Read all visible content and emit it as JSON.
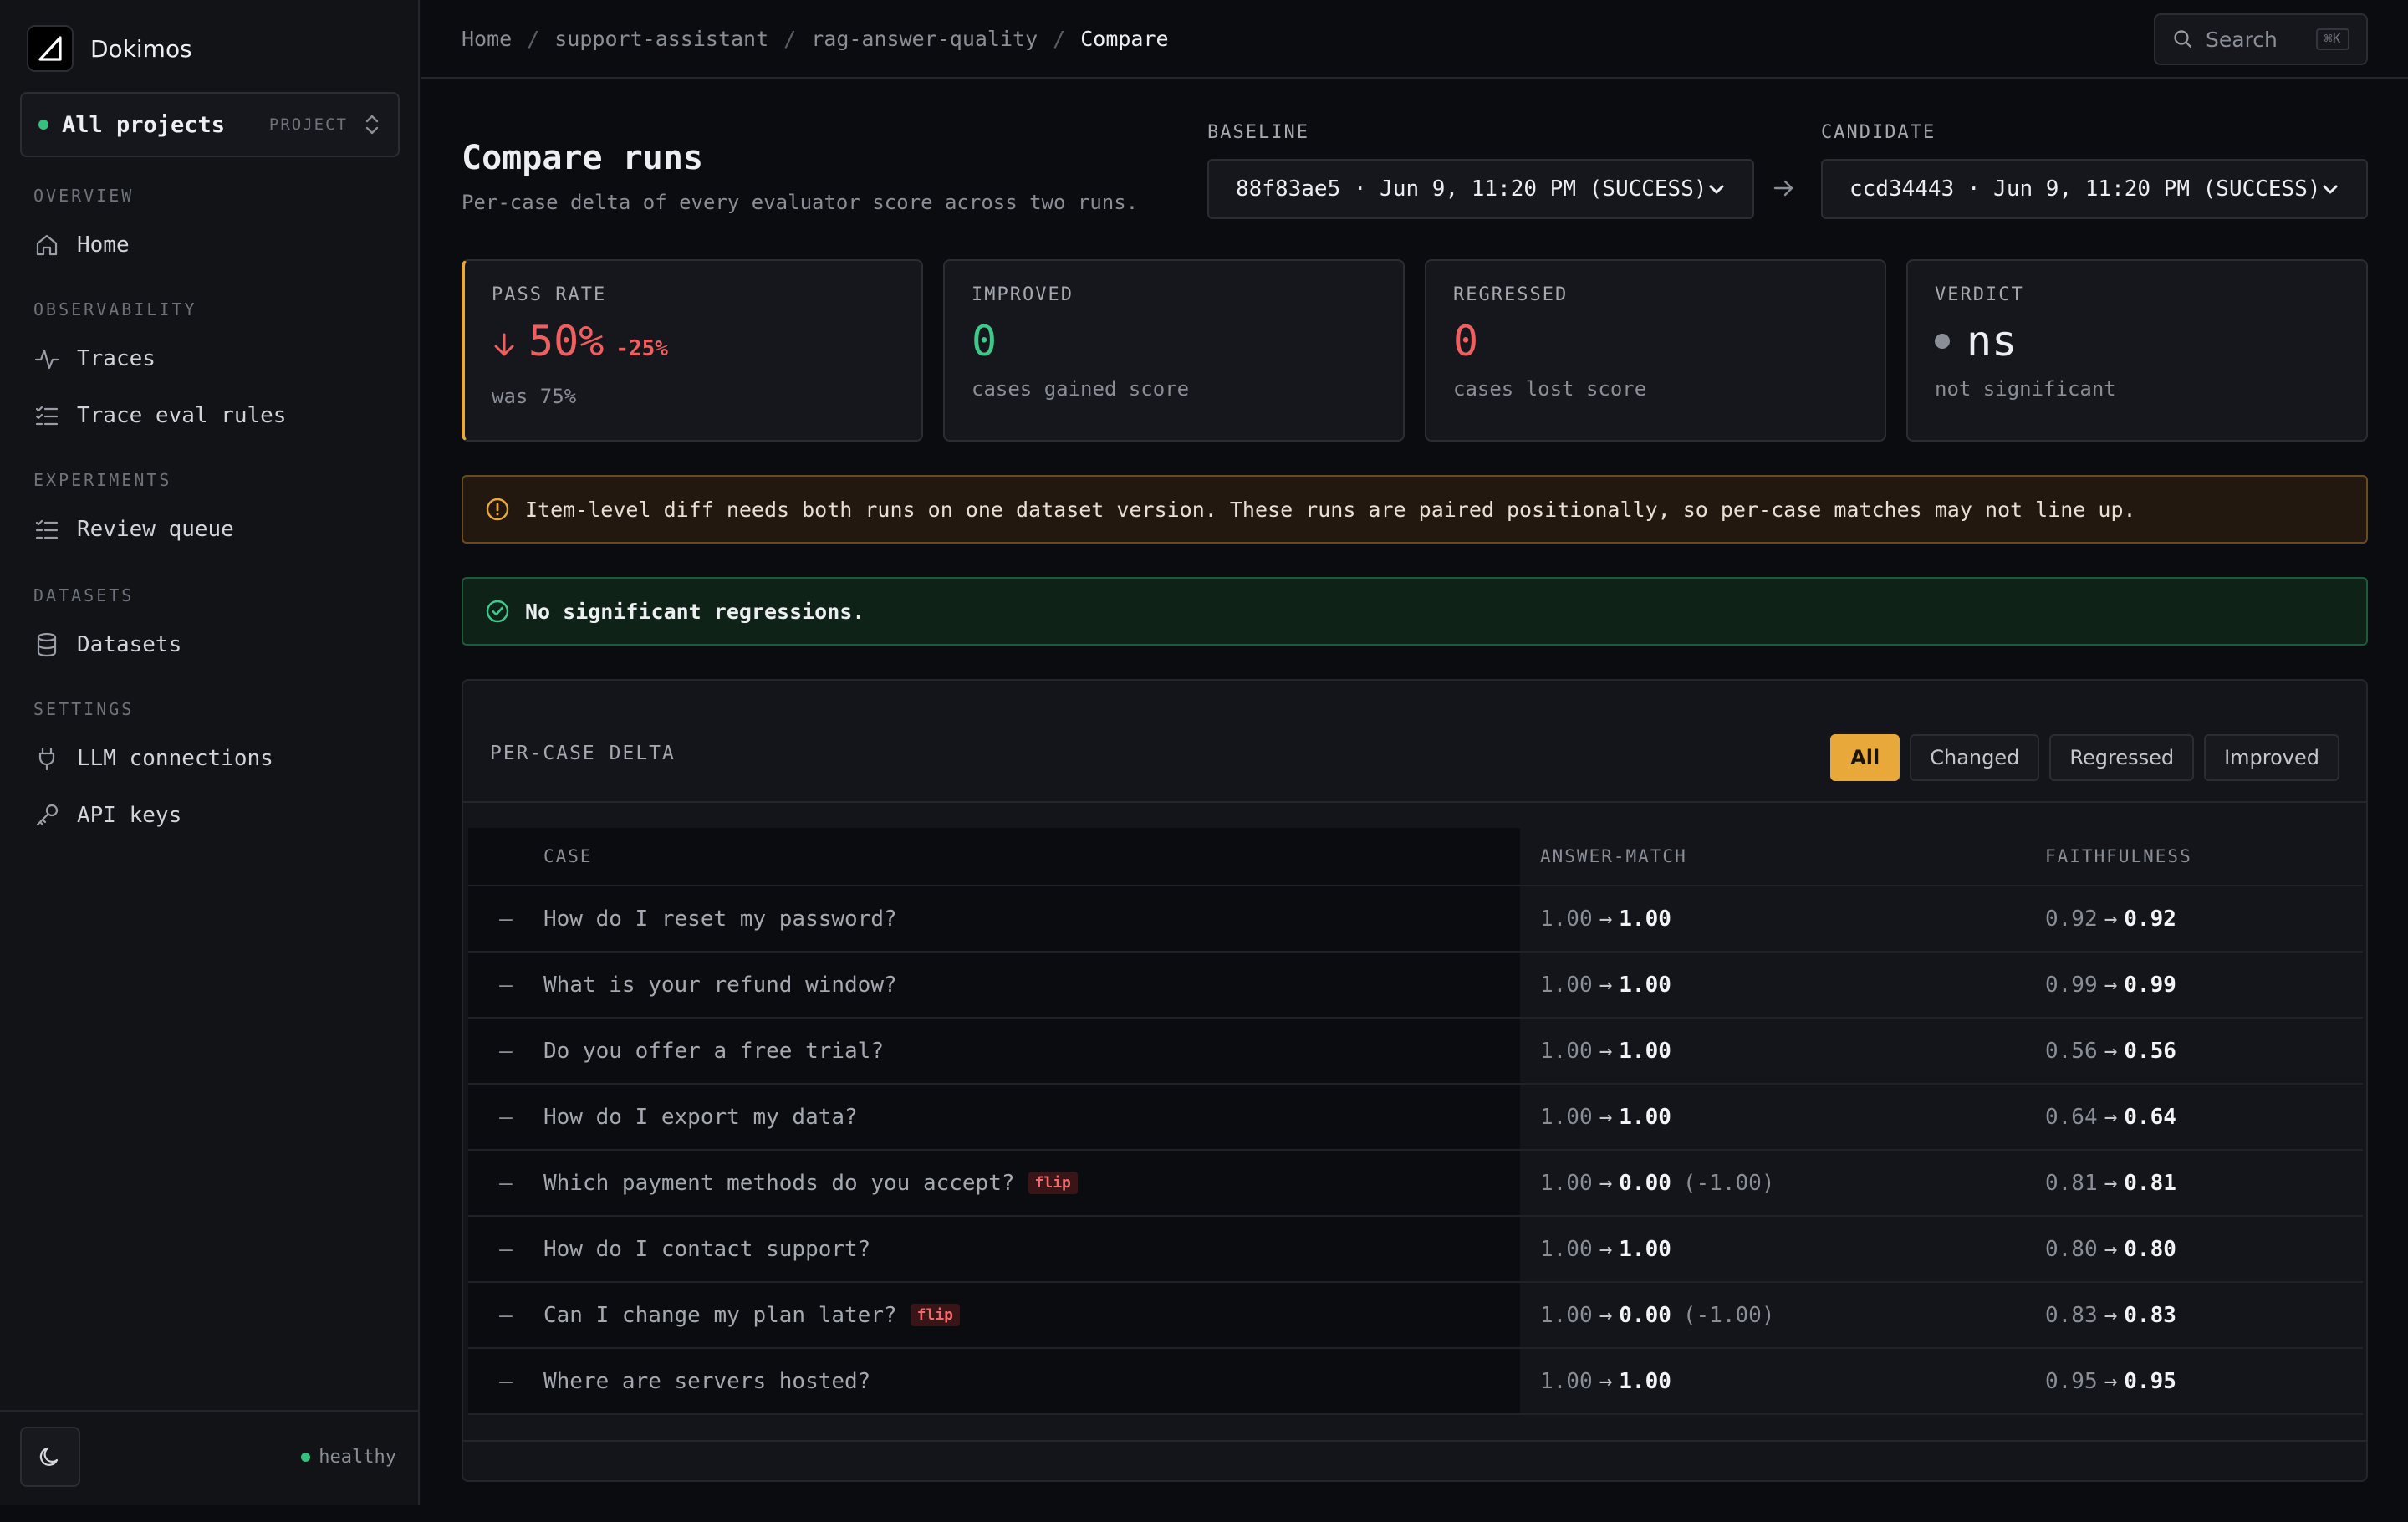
{
  "app": {
    "name": "Dokimos"
  },
  "project": {
    "name": "All projects",
    "tag": "PROJECT"
  },
  "nav": {
    "sections": [
      {
        "title": "OVERVIEW",
        "items": [
          {
            "label": "Home",
            "icon": "home-icon"
          }
        ]
      },
      {
        "title": "OBSERVABILITY",
        "items": [
          {
            "label": "Traces",
            "icon": "activity-icon"
          },
          {
            "label": "Trace eval rules",
            "icon": "list-check-icon"
          }
        ]
      },
      {
        "title": "EXPERIMENTS",
        "items": [
          {
            "label": "Review queue",
            "icon": "list-icon"
          }
        ]
      },
      {
        "title": "DATASETS",
        "items": [
          {
            "label": "Datasets",
            "icon": "database-icon"
          }
        ]
      },
      {
        "title": "SETTINGS",
        "items": [
          {
            "label": "LLM connections",
            "icon": "plug-icon"
          },
          {
            "label": "API keys",
            "icon": "key-icon"
          }
        ]
      }
    ]
  },
  "footer": {
    "status": "healthy"
  },
  "breadcrumb": [
    "Home",
    "support-assistant",
    "rag-answer-quality",
    "Compare"
  ],
  "search": {
    "label": "Search",
    "shortcut": "⌘K"
  },
  "page": {
    "title": "Compare runs",
    "subtitle": "Per-case delta of every evaluator score across two runs."
  },
  "baseline": {
    "label": "BASELINE",
    "value": "88f83ae5 · Jun 9, 11:20 PM (SUCCESS)"
  },
  "candidate": {
    "label": "CANDIDATE",
    "value": "ccd34443 · Jun 9, 11:20 PM (SUCCESS)"
  },
  "stats": {
    "pass_rate": {
      "label": "PASS RATE",
      "value": "50%",
      "delta": "-25%",
      "sub": "was 75%"
    },
    "improved": {
      "label": "IMPROVED",
      "value": "0",
      "sub": "cases gained score"
    },
    "regressed": {
      "label": "REGRESSED",
      "value": "0",
      "sub": "cases lost score"
    },
    "verdict": {
      "label": "VERDICT",
      "value": "ns",
      "sub": "not significant"
    }
  },
  "warning": "Item-level diff needs both runs on one dataset version. These runs are paired positionally, so per-case matches may not line up.",
  "success": "No significant regressions.",
  "table": {
    "title": "PER-CASE DELTA",
    "filters": [
      "All",
      "Changed",
      "Regressed",
      "Improved"
    ],
    "active_filter": "All",
    "columns": [
      "CASE",
      "ANSWER-MATCH",
      "FAITHFULNESS"
    ],
    "arrow": "→",
    "flip_label": "flip",
    "rows": [
      {
        "mark": "—",
        "case": "How do I reset my password?",
        "am_from": "1.00",
        "am_to": "1.00",
        "am_delta": "",
        "ff_from": "0.92",
        "ff_to": "0.92",
        "flip": false
      },
      {
        "mark": "—",
        "case": "What is your refund window?",
        "am_from": "1.00",
        "am_to": "1.00",
        "am_delta": "",
        "ff_from": "0.99",
        "ff_to": "0.99",
        "flip": false
      },
      {
        "mark": "—",
        "case": "Do you offer a free trial?",
        "am_from": "1.00",
        "am_to": "1.00",
        "am_delta": "",
        "ff_from": "0.56",
        "ff_to": "0.56",
        "flip": false
      },
      {
        "mark": "—",
        "case": "How do I export my data?",
        "am_from": "1.00",
        "am_to": "1.00",
        "am_delta": "",
        "ff_from": "0.64",
        "ff_to": "0.64",
        "flip": false
      },
      {
        "mark": "—",
        "case": "Which payment methods do you accept?",
        "am_from": "1.00",
        "am_to": "0.00",
        "am_delta": "(-1.00)",
        "ff_from": "0.81",
        "ff_to": "0.81",
        "flip": true
      },
      {
        "mark": "—",
        "case": "How do I contact support?",
        "am_from": "1.00",
        "am_to": "1.00",
        "am_delta": "",
        "ff_from": "0.80",
        "ff_to": "0.80",
        "flip": false
      },
      {
        "mark": "—",
        "case": "Can I change my plan later?",
        "am_from": "1.00",
        "am_to": "0.00",
        "am_delta": "(-1.00)",
        "ff_from": "0.83",
        "ff_to": "0.83",
        "flip": true
      },
      {
        "mark": "—",
        "case": "Where are servers hosted?",
        "am_from": "1.00",
        "am_to": "1.00",
        "am_delta": "",
        "ff_from": "0.95",
        "ff_to": "0.95",
        "flip": false
      }
    ]
  },
  "colors": {
    "accent": "#e8a93a",
    "danger": "#ef5f5f",
    "success": "#3dc98a",
    "background": "#0b0c0f"
  }
}
